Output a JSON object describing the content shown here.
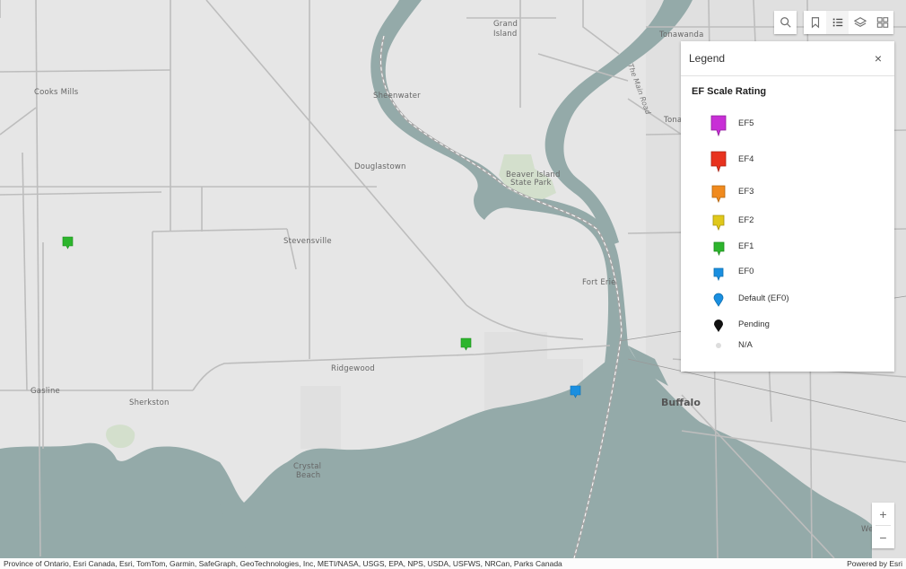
{
  "map": {
    "places": [
      {
        "id": "cooks-mills",
        "name": "Cooks Mills"
      },
      {
        "id": "sheenwater",
        "name": "Sheenwater"
      },
      {
        "id": "douglastown",
        "name": "Douglastown"
      },
      {
        "id": "stevensville",
        "name": "Stevensville"
      },
      {
        "id": "fort-erie",
        "name": "Fort Erie"
      },
      {
        "id": "ridgewood",
        "name": "Ridgewood"
      },
      {
        "id": "gasline",
        "name": "Gasline"
      },
      {
        "id": "sherkston",
        "name": "Sherkston"
      },
      {
        "id": "crystal-beach-1",
        "name": "Crystal"
      },
      {
        "id": "crystal-beach-2",
        "name": "Beach"
      },
      {
        "id": "grand-island-1",
        "name": "Grand"
      },
      {
        "id": "grand-island-2",
        "name": "Island"
      },
      {
        "id": "beaver-island-1",
        "name": "Beaver Island"
      },
      {
        "id": "beaver-island-2",
        "name": "State Park"
      },
      {
        "id": "tonawanda",
        "name": "Tonawanda"
      },
      {
        "id": "tonawanda-partial",
        "name": "Tona"
      },
      {
        "id": "buffalo",
        "name": "Buffalo"
      },
      {
        "id": "west-seneca",
        "name": "West Se"
      },
      {
        "id": "road-label",
        "name": "The Main Road"
      }
    ],
    "markers": [
      {
        "id": "marker-1",
        "rating": "EF1",
        "color": "#2db52d"
      },
      {
        "id": "marker-2",
        "rating": "EF1",
        "color": "#2db52d"
      },
      {
        "id": "marker-3",
        "rating": "EF0",
        "color": "#1a8fe0"
      }
    ]
  },
  "toolbar": {
    "buttons": [
      {
        "id": "search",
        "icon": "search-icon"
      },
      {
        "id": "bookmarks",
        "icon": "bookmark-icon"
      },
      {
        "id": "legend",
        "icon": "legend-icon"
      },
      {
        "id": "layers",
        "icon": "layers-icon"
      },
      {
        "id": "basemap",
        "icon": "basemap-gallery-icon"
      }
    ]
  },
  "legend": {
    "title": "Legend",
    "close": "×",
    "layer_title": "EF Scale Rating",
    "items": [
      {
        "label": "EF5",
        "color": "#c82fd6"
      },
      {
        "label": "EF4",
        "color": "#e8321e"
      },
      {
        "label": "EF3",
        "color": "#f08a1e"
      },
      {
        "label": "EF2",
        "color": "#e0c81a"
      },
      {
        "label": "EF1",
        "color": "#2db52d"
      },
      {
        "label": "EF0",
        "color": "#1a8fe0"
      },
      {
        "label": "Default (EF0)",
        "color": "#1a8fe0"
      },
      {
        "label": "Pending",
        "color": "#111111"
      },
      {
        "label": "N/A",
        "color": "#dddddd"
      }
    ]
  },
  "zoom": {
    "in": "+",
    "out": "−"
  },
  "attribution": {
    "text": "Province of Ontario, Esri Canada, Esri, TomTom, Garmin, SafeGraph, GeoTechnologies, Inc, METI/NASA, USGS, EPA, NPS, USDA, USFWS, NRCan, Parks Canada",
    "powered_by": "Powered by Esri"
  },
  "colors": {
    "land": "#e6e6e6",
    "water": "#94aaa9",
    "road": "#bdbdbd",
    "park": "#d3dfcc"
  }
}
